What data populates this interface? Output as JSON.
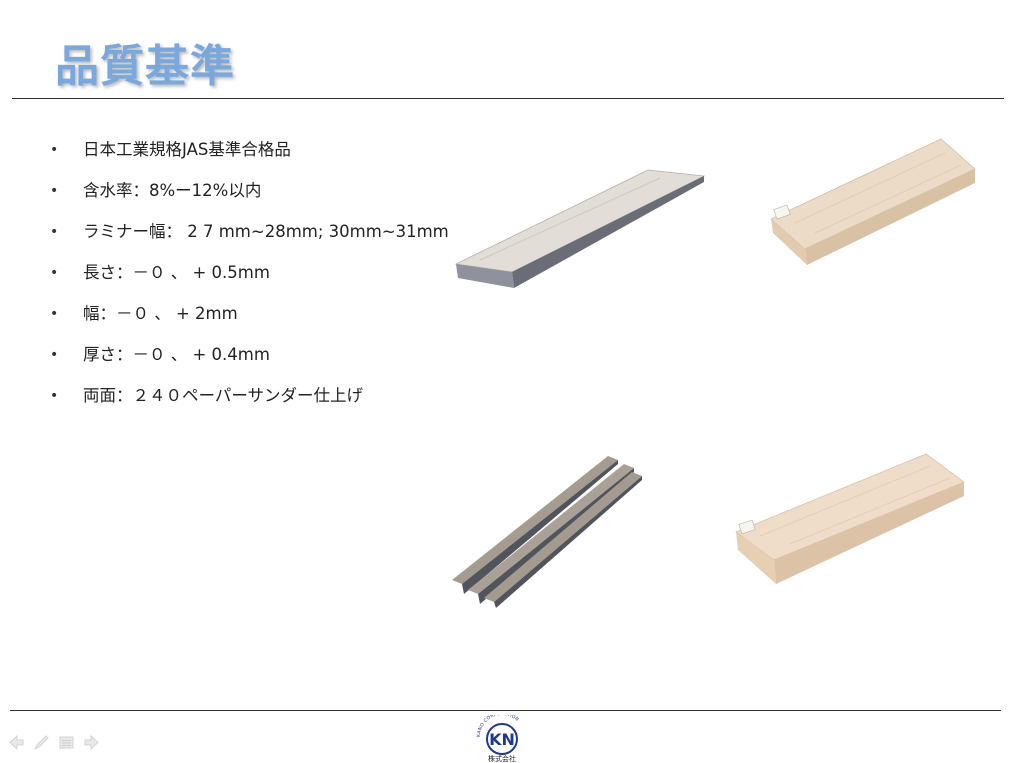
{
  "slide": {
    "title": "品質基準",
    "bullets": [
      "日本工業規格JAS基準合格品",
      "含水率：8%ー12%以内",
      "ラミナー幅： 2 7 mm~28mm; 30mm~31mm",
      "長さ：－０ 、 + 0.5mm",
      "幅：－０ 、 + 2mm",
      "厚さ：－０ 、 + 0.4mm",
      "両面：２４０ペーパーサンダー仕上げ"
    ],
    "bullet_glyph": "•"
  },
  "logo": {
    "ring_text": "KANO CORPORATION",
    "letters": "KN",
    "caption": "株式会社"
  },
  "nav": {
    "icons": [
      "arrow-left-icon",
      "pen-icon",
      "menu-icon",
      "arrow-right-icon"
    ]
  },
  "colors": {
    "title": "#7aa8dc",
    "wood_light": "#e6d8c8",
    "wood_edge": "#c7b29f",
    "gray_edge": "#6f6f78"
  }
}
